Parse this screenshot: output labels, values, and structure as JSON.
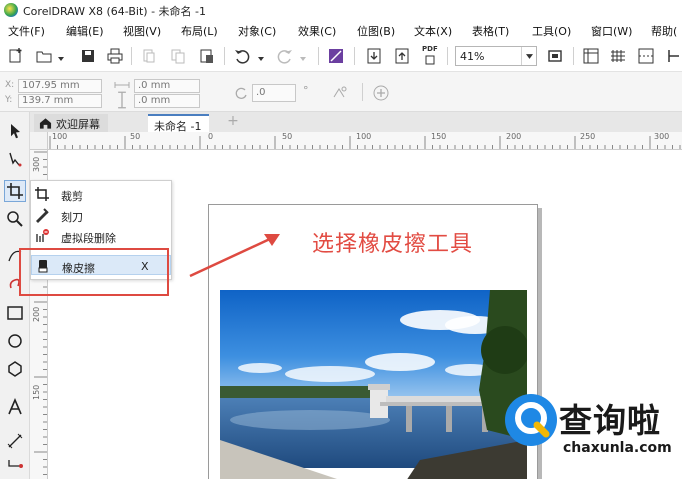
{
  "window": {
    "title": "CorelDRAW X8 (64-Bit) - 未命名 -1"
  },
  "menu": {
    "items": [
      "文件(F)",
      "编辑(E)",
      "视图(V)",
      "布局(L)",
      "对象(C)",
      "效果(C)",
      "位图(B)",
      "文本(X)",
      "表格(T)",
      "工具(O)",
      "窗口(W)",
      "帮助("
    ]
  },
  "toolbar": {
    "zoom": "41%",
    "pdf_label": "PDF"
  },
  "property_bar": {
    "x_label": "X:",
    "y_label": "Y:",
    "x_value": "107.95 mm",
    "y_value": "139.7 mm",
    "width_value": ".0 mm",
    "height_value": ".0 mm",
    "rotation_value": ".0",
    "degree_symbol": "°"
  },
  "tabs": {
    "welcome": "欢迎屏幕",
    "document": "未命名 -1",
    "add": "+"
  },
  "ruler": {
    "horizontal": [
      "100",
      "50",
      "0",
      "50",
      "100",
      "150",
      "200",
      "250",
      "300"
    ],
    "vertical": [
      "300",
      "250",
      "200",
      "150"
    ]
  },
  "flyout": {
    "items": [
      {
        "label": "裁剪",
        "shortcut": ""
      },
      {
        "label": "刻刀",
        "shortcut": ""
      },
      {
        "label": "虚拟段删除",
        "shortcut": ""
      },
      {
        "label": "橡皮擦",
        "shortcut": "X"
      }
    ]
  },
  "annotation": {
    "text": "选择橡皮擦工具",
    "color": "#e24c43"
  },
  "watermark": {
    "chinese": "查询啦",
    "domain": "chaxunla.com"
  },
  "colors": {
    "accent_blue": "#4a7ec0",
    "highlight": "#dbe9f8",
    "annotation_red": "#de4a41"
  }
}
